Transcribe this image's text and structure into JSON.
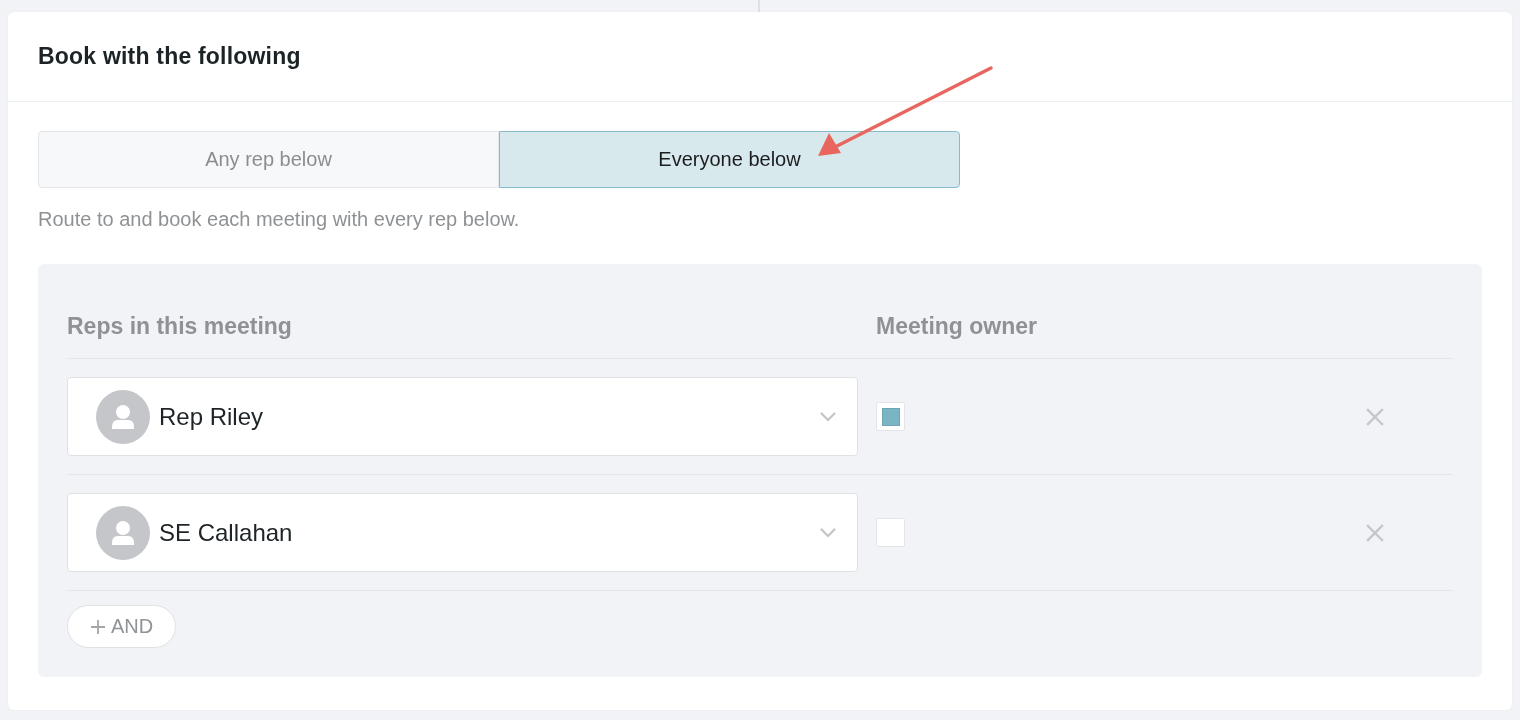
{
  "card": {
    "title": "Book with the following"
  },
  "booking_mode": {
    "options": [
      {
        "label": "Any rep below",
        "selected": false
      },
      {
        "label": "Everyone below",
        "selected": true
      }
    ],
    "description": "Route to and book each meeting with every rep below."
  },
  "reps_table": {
    "columns": [
      "Reps in this meeting",
      "Meeting owner"
    ],
    "rows": [
      {
        "rep": "Rep Riley",
        "owner_checked": true
      },
      {
        "rep": "SE Callahan",
        "owner_checked": false
      }
    ],
    "add_button": "AND"
  }
}
